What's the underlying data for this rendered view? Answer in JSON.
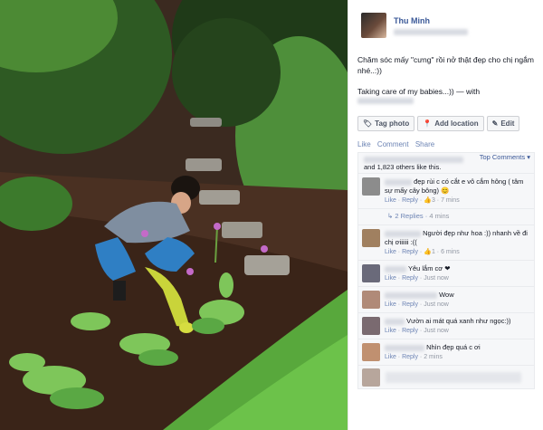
{
  "post": {
    "author": "Thu Minh",
    "caption": "Chăm sóc mấy \"cưng\" rồi nở thật đẹp cho chị ngắm nhé..:))",
    "caption2": "Taking care of my babies...)) — with"
  },
  "actions": [
    {
      "label": "Tag photo",
      "icon": "tag-icon"
    },
    {
      "label": "Add location",
      "icon": "location-pin-icon"
    },
    {
      "label": "Edit",
      "icon": "pencil-icon"
    }
  ],
  "links": {
    "like": "Like",
    "comment": "Comment",
    "share": "Share"
  },
  "likes": {
    "text": "and 1,823 others like this.",
    "sort": "Top Comments"
  },
  "comments": [
    {
      "text": "đẹp rùi c có cắt e vô cắm hông ( tâm sự mấy cây bông) 😊",
      "meta_time": "7 mins",
      "like_count": "3",
      "avatar_color": "#8c8c8c"
    },
    {
      "text": "Người đẹp như hoa :)) nhanh về đi chị ơiiiiii :((",
      "meta_time": "6 mins",
      "like_count": "1",
      "avatar_color": "#a08060"
    },
    {
      "text": "Yêu lắm cơ ❤",
      "meta_time": "Just now",
      "like_count": "",
      "avatar_color": "#6a6a7a"
    },
    {
      "text": "Wow",
      "meta_time": "Just now",
      "like_count": "",
      "avatar_color": "#b08a78"
    },
    {
      "text": "Vườn ai mát quá xanh như ngọc:))",
      "meta_time": "Just now",
      "like_count": "",
      "avatar_color": "#7a6a70"
    },
    {
      "text": "Nhìn đẹp quá c ơi",
      "meta_time": "2 mins",
      "like_count": "",
      "avatar_color": "#c09070"
    }
  ],
  "replies": "2 Replies",
  "replies_time": "4 mins",
  "meta": {
    "like": "Like",
    "reply": "Reply"
  }
}
